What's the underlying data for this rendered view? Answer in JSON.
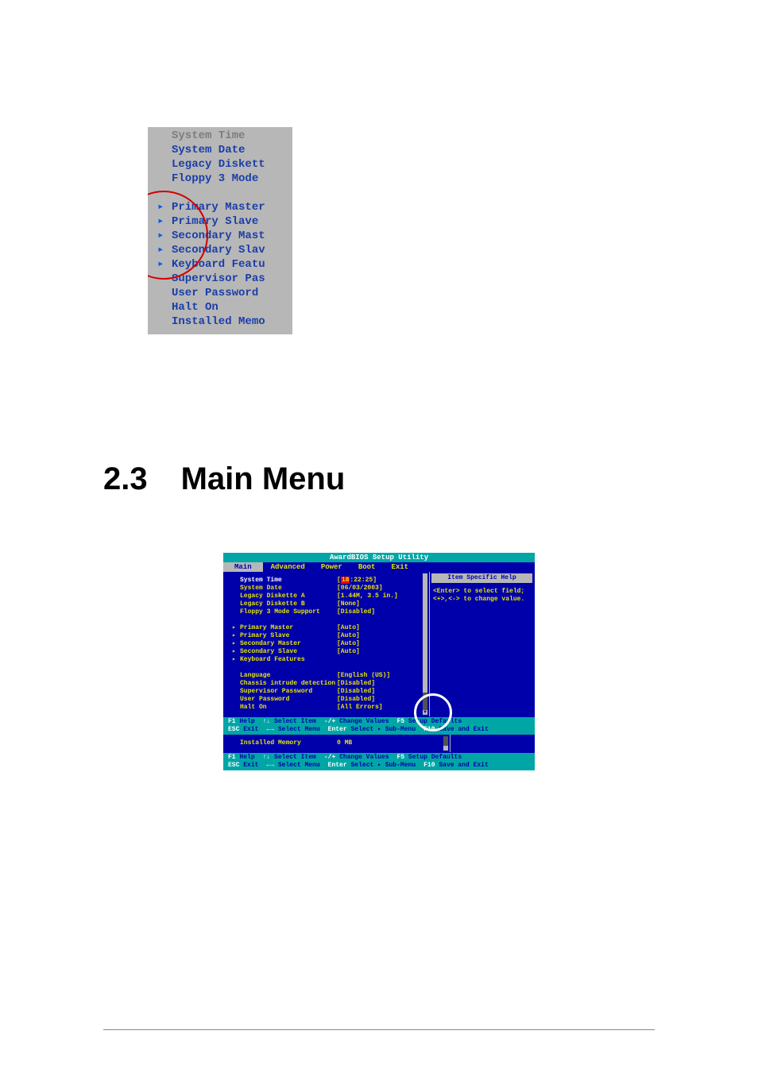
{
  "crop": {
    "lines": [
      {
        "tri": false,
        "text": "System Time",
        "dim": true
      },
      {
        "tri": false,
        "text": "System Date"
      },
      {
        "tri": false,
        "text": "Legacy Diskett"
      },
      {
        "tri": false,
        "text": "Floppy 3 Mode"
      },
      {
        "gap": true
      },
      {
        "tri": true,
        "text": "Primary Master"
      },
      {
        "tri": true,
        "text": "Primary Slave"
      },
      {
        "tri": true,
        "text": "Secondary Mast"
      },
      {
        "tri": true,
        "text": "Secondary Slav"
      },
      {
        "tri": true,
        "text": "Keyboard Featu"
      },
      {
        "tri": false,
        "text": "Supervisor Pas"
      },
      {
        "tri": false,
        "text": "User Password"
      },
      {
        "tri": false,
        "text": "Halt On"
      },
      {
        "tri": false,
        "text": "Installed Memo"
      }
    ]
  },
  "heading": {
    "num": "2.3",
    "title": "Main Menu"
  },
  "bios": {
    "title": "AwardBIOS Setup Utility",
    "tabs": [
      "Main",
      "Advanced",
      "Power",
      "Boot",
      "Exit"
    ],
    "active_tab": "Main",
    "help_title": "Item Specific Help",
    "help_lines": [
      "<Enter> to select field;",
      "<+>,<-> to change value."
    ],
    "rows_block1": [
      {
        "tri": false,
        "sel": true,
        "label": "System Time",
        "val_pre": "[",
        "val_hl": "18",
        "val_post": ":22:25]"
      },
      {
        "tri": false,
        "sel": false,
        "label": "System Date",
        "val": "[06/03/2003]"
      },
      {
        "tri": false,
        "sel": false,
        "label": "Legacy Diskette A",
        "val": "[1.44M, 3.5 in.]"
      },
      {
        "tri": false,
        "sel": false,
        "label": "Legacy Diskette B",
        "val": "[None]"
      },
      {
        "tri": false,
        "sel": false,
        "label": "Floppy 3 Mode Support",
        "val": "[Disabled]"
      }
    ],
    "rows_block2": [
      {
        "tri": true,
        "label": "Primary Master",
        "val": "[Auto]"
      },
      {
        "tri": true,
        "label": "Primary Slave",
        "val": "[Auto]"
      },
      {
        "tri": true,
        "label": "Secondary Master",
        "val": "[Auto]"
      },
      {
        "tri": true,
        "label": "Secondary Slave",
        "val": "[Auto]"
      },
      {
        "tri": true,
        "label": "Keyboard Features",
        "val": ""
      }
    ],
    "rows_block3": [
      {
        "tri": false,
        "label": "Language",
        "val": "[English (US)]"
      },
      {
        "tri": false,
        "label": "Chassis intrude detection",
        "val": "[Disabled]"
      },
      {
        "tri": false,
        "label": "Supervisor Password",
        "val": "[Disabled]"
      },
      {
        "tri": false,
        "label": "User Password",
        "val": "[Disabled]"
      },
      {
        "tri": false,
        "label": "Halt On",
        "val": "[All Errors]"
      }
    ],
    "footer1": {
      "row1": [
        "F1",
        "Help",
        "↑↓",
        "Select Item",
        "-/+",
        "Change Values",
        "F5",
        "Setup Defaults"
      ],
      "row2": [
        "ESC",
        "Exit",
        "←→",
        "Select Menu",
        "Enter",
        "Select ▸ Sub-Menu",
        "F10",
        "Save and Exit"
      ]
    },
    "extra_row": {
      "label": "Installed Memory",
      "val": "0 MB"
    },
    "footer2": {
      "row1": [
        "F1",
        "Help",
        "↑↓",
        "Select Item",
        "-/+",
        "Change Values",
        "F5",
        "Setup Defaults"
      ],
      "row2": [
        "ESC",
        "Exit",
        "←→",
        "Select Menu",
        "Enter",
        "Select ▸ Sub-Menu",
        "F10",
        "Save and Exit"
      ]
    }
  },
  "page_footer": {
    "left": "",
    "right": ""
  }
}
